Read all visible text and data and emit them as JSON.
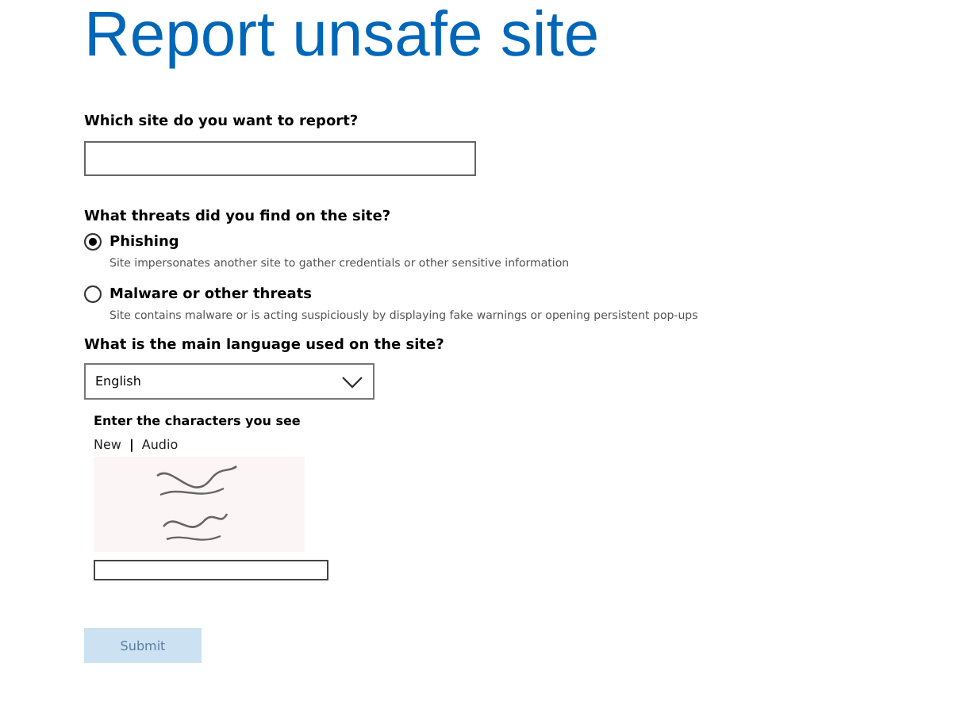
{
  "title": "Report unsafe site",
  "site_field": {
    "label": "Which site do you want to report?"
  },
  "threats": {
    "label": "What threats did you find on the site?",
    "options": [
      {
        "label": "Phishing",
        "description": "Site impersonates another site to gather credentials or other sensitive information",
        "selected": true
      },
      {
        "label": "Malware or other threats",
        "description": "Site contains malware or is acting suspiciously by displaying fake warnings or opening persistent pop-ups",
        "selected": false
      }
    ]
  },
  "language": {
    "label": "What is the main language used on the site?",
    "value": "English"
  },
  "captcha": {
    "label": "Enter the characters you see",
    "links": [
      "New",
      "Audio"
    ],
    "separator": "|"
  },
  "submit": {
    "label": "Submit",
    "disabled": true
  }
}
